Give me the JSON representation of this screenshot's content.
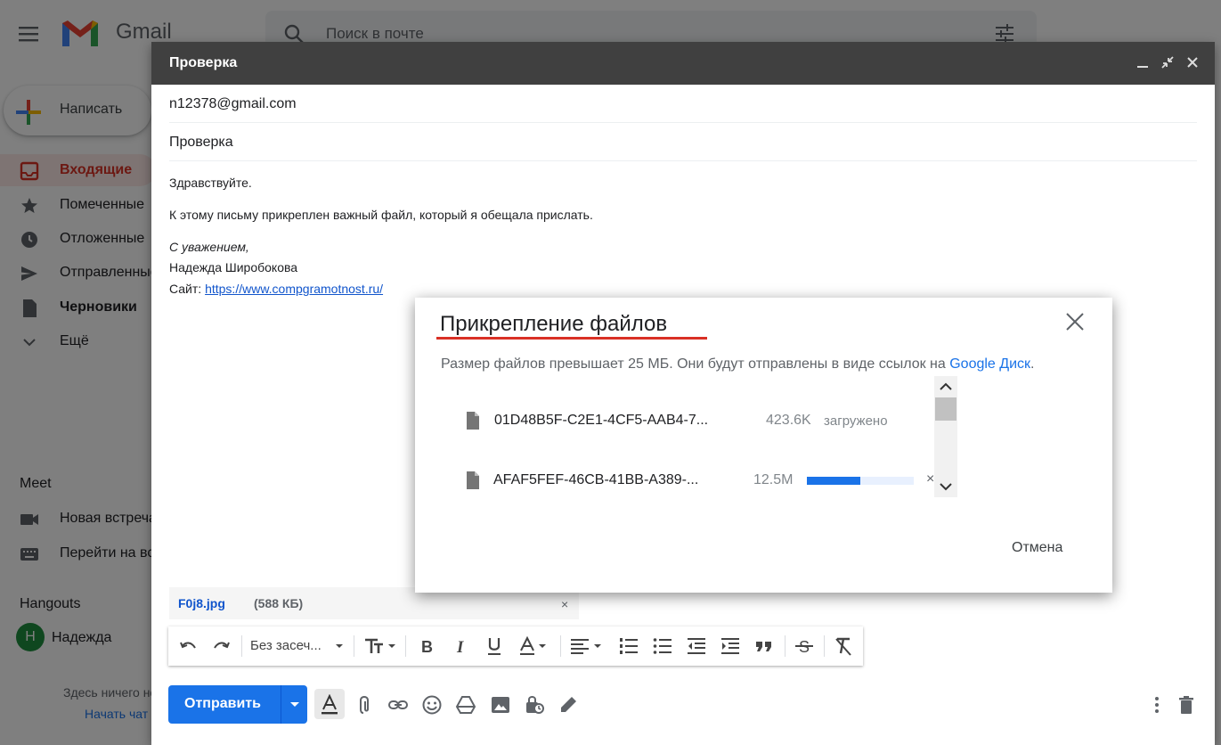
{
  "app": {
    "name": "Gmail",
    "search_placeholder": "Поиск в почте",
    "compose_label": "Написать"
  },
  "sidebar": {
    "items": [
      {
        "label": "Входящие",
        "icon": "inbox-icon",
        "active": true
      },
      {
        "label": "Помеченные",
        "icon": "star-icon"
      },
      {
        "label": "Отложенные",
        "icon": "clock-icon"
      },
      {
        "label": "Отправленные",
        "icon": "send-icon"
      },
      {
        "label": "Черновики",
        "icon": "draft-icon",
        "bold": true
      },
      {
        "label": "Ещё",
        "icon": "chevron-down-icon"
      }
    ],
    "meet": {
      "title": "Meet",
      "items": [
        {
          "label": "Новая встреча",
          "icon": "videocam-icon"
        },
        {
          "label": "Перейти на встречу",
          "icon": "keyboard-icon"
        }
      ]
    },
    "hangouts": {
      "title": "Hangouts",
      "user": "Надежда",
      "avatar_letter": "Н",
      "empty_text": "Здесь ничего нет",
      "start_chat": "Начать чат"
    }
  },
  "compose": {
    "title": "Проверка",
    "to": "n12378@gmail.com",
    "subject": "Проверка",
    "body": {
      "greeting": "Здравствуйте.",
      "line1": "К этому письму прикреплен важный файл, который я обещала прислать.",
      "signoff": "С уважением,",
      "name": "Надежда Широбокова",
      "site_label": "Сайт: ",
      "site_url": "https://www.compgramotnost.ru/"
    },
    "attachment": {
      "name": "F0j8.jpg",
      "size": "(588 КБ)",
      "close": "×"
    },
    "font_name": "Без засеч...",
    "send_label": "Отправить"
  },
  "dialog": {
    "title": "Прикрепление файлов",
    "message": "Размер файлов превышает 25 МБ. Они будут отправлены в виде ссылок на ",
    "drive_link": "Google Диск",
    "message_end": ".",
    "files": [
      {
        "name": "01D48B5F-C2E1-4CF5-AAB4-7...",
        "size": "423.6K",
        "status": "загружено"
      },
      {
        "name": "AFAF5FEF-46CB-41BB-A389-...",
        "size": "12.5M",
        "progress": 0.5,
        "cancel": "×"
      }
    ],
    "cancel_label": "Отмена"
  },
  "colors": {
    "accent": "#1a73e8",
    "danger": "#d93025",
    "header": "#404040"
  }
}
